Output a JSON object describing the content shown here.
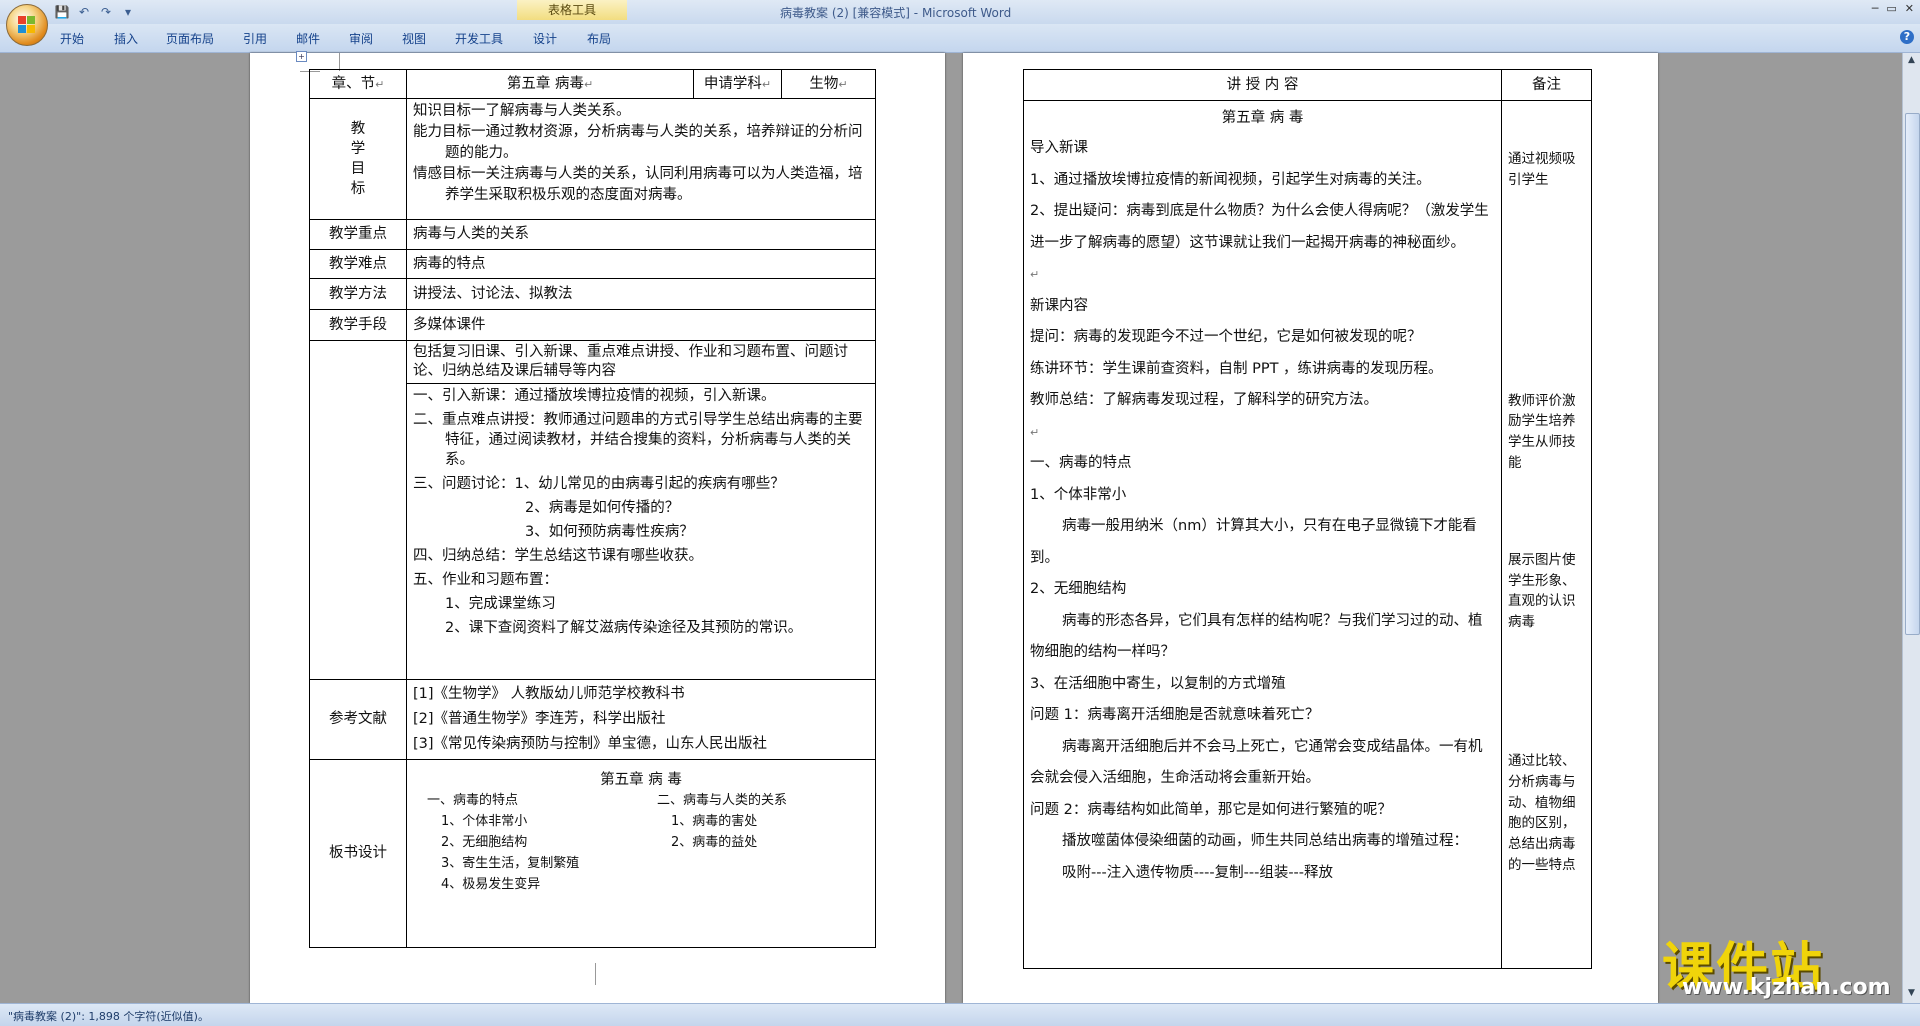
{
  "window": {
    "title": "病毒教案 (2) [兼容模式] - Microsoft Word",
    "context_tab_group": "表格工具",
    "controls": [
      "─",
      "▭",
      "✕"
    ]
  },
  "ribbon": {
    "tabs": [
      "开始",
      "插入",
      "页面布局",
      "引用",
      "邮件",
      "审阅",
      "视图",
      "开发工具",
      "设计",
      "布局"
    ]
  },
  "quick_access": [
    "save-icon",
    "undo-icon",
    "redo-icon",
    "customize-icon"
  ],
  "status": {
    "text": "\"病毒教案 (2)\": 1,898 个字符(近似值)。"
  },
  "left_page": {
    "header": {
      "col1": "章、节",
      "col2": "第五章  病毒",
      "col3": "申请学科",
      "col4": "生物"
    },
    "goals": {
      "label": "教\n学\n目\n标",
      "items": [
        "知识目标一了解病毒与人类关系。",
        "能力目标一通过教材资源，分析病毒与人类的关系，培养辩证的分析问题的能力。",
        "情感目标一关注病毒与人类的关系，认同利用病毒可以为人类造福，培养学生采取积极乐观的态度面对病毒。"
      ]
    },
    "key_point": {
      "label": "教学重点",
      "value": "病毒与人类的关系"
    },
    "difficulty": {
      "label": "教学难点",
      "value": "病毒的特点"
    },
    "method": {
      "label": "教学方法",
      "value": "讲授法、讨论法、拟教法"
    },
    "means": {
      "label": "教学手段",
      "value": "多媒体课件"
    },
    "process_intro": "包括复习旧课、引入新课、重点难点讲授、作业和习题布置、问题讨论、归纳总结及课后辅导等内容",
    "process": {
      "step1": "一、引入新课：通过播放埃博拉疫情的视频，引入新课。",
      "step2": "二、重点难点讲授：教师通过问题串的方式引导学生总结出病毒的主要特征，通过阅读教材，并结合搜集的资料，分析病毒与人类的关系。",
      "step3_a": "三、问题讨论：1、幼儿常见的由病毒引起的疾病有哪些？",
      "step3_b": "2、病毒是如何传播的？",
      "step3_c": "3、如何预防病毒性疾病？",
      "step4": "四、归纳总结：学生总结这节课有哪些收获。",
      "step5": "五、作业和习题布置：",
      "step5_1": "1、完成课堂练习",
      "step5_2": "2、课下查阅资料了解艾滋病传染途径及其预防的常识。"
    },
    "refs": {
      "label": "参考文献",
      "items": [
        "[1]《生物学》 人教版幼儿师范学校教科书",
        "[2]《普通生物学》李连芳，科学出版社",
        "[3]《常见传染病预防与控制》单宝德，山东人民出版社"
      ]
    },
    "board": {
      "label": "板书设计",
      "title": "第五章    病    毒",
      "left_head": "一、病毒的特点",
      "left_items": [
        "1、个体非常小",
        "2、无细胞结构",
        "3、寄生生活，复制繁殖",
        "4、极易发生变异"
      ],
      "right_head": "二、病毒与人类的关系",
      "right_items": [
        "1、病毒的害处",
        "2、病毒的益处"
      ]
    }
  },
  "right_page": {
    "header": {
      "content": "讲    授    内    容",
      "notes": "备注"
    },
    "title": "第五章    病    毒",
    "paragraphs": [
      "导入新课",
      "1、通过播放埃博拉疫情的新闻视频，引起学生对病毒的关注。",
      "2、提出疑问：病毒到底是什么物质？为什么会使人得病呢？（激发学生进一步了解病毒的愿望）这节课就让我们一起揭开病毒的神秘面纱。",
      "",
      "新课内容",
      "提问：病毒的发现距今不过一个世纪，它是如何被发现的呢？",
      "练讲环节：学生课前查资料，自制 PPT ，练讲病毒的发现历程。",
      "教师总结：了解病毒发现过程，了解科学的研究方法。",
      "",
      "一、病毒的特点",
      "1、个体非常小",
      "病毒一般用纳米（nm）计算其大小，只有在电子显微镜下才能看到。",
      "2、无细胞结构",
      "病毒的形态各异，它们具有怎样的结构呢？与我们学习过的动、植物细胞的结构一样吗？",
      "3、在活细胞中寄生，以复制的方式增殖",
      "问题 1：病毒离开活细胞是否就意味着死亡？",
      "病毒离开活细胞后并不会马上死亡，它通常会变成结晶体。一有机会就会侵入活细胞，生命活动将会重新开始。",
      "问题 2：病毒结构如此简单，那它是如何进行繁殖的呢？",
      "播放噬菌体侵染细菌的动画，师生共同总结出病毒的增殖过程：",
      "吸附---注入遗传物质----复制---组装---释放",
      ""
    ],
    "notes": {
      "n1": "通过视频吸引学生",
      "n2": "教师评价激励学生培养学生从师技能",
      "n3": "展示图片使学生形象、直观的认识病毒",
      "n4": "通过比较、分析病毒与动、植物细胞的区别，总结出病毒的一些特点"
    }
  },
  "watermark": {
    "main": "课件站",
    "url": "www.kjzhan.com"
  }
}
